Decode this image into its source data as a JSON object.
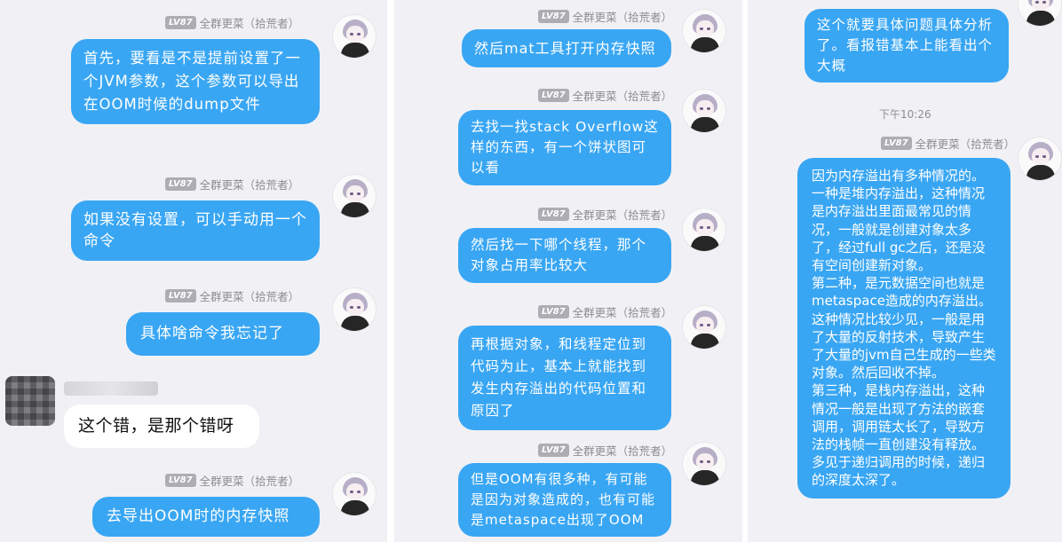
{
  "sender": {
    "level": "LV87",
    "name": "全群更菜",
    "title": "（拾荒者）"
  },
  "panel1": {
    "messages": [
      "首先，要看是不是提前设置了一个JVM参数，这个参数可以导出在OOM时候的dump文件",
      "如果没有设置，可以手动用一个命令",
      "具体啥命令我忘记了"
    ],
    "other_message": "这个错，是那个错呀",
    "last_message": "去导出OOM时的内存快照"
  },
  "panel2": {
    "messages": [
      "然后mat工具打开内存快照",
      "去找一找stack Overflow这样的东西，有一个饼状图可以看",
      "然后找一下哪个线程，那个对象占用率比较大",
      "再根据对象，和线程定位到代码为止，基本上就能找到发生内存溢出的代码位置和原因了",
      "但是OOM有很多种，有可能是因为对象造成的，也有可能是metaspace出现了OOM"
    ]
  },
  "panel3": {
    "top_message": "这个就要具体问题具体分析了。看报错基本上能看出个大概",
    "time": "下午10:26",
    "long_message": "因为内存溢出有多种情况的。\n一种是堆内存溢出，这种情况是内存溢出里面最常见的情况，一般就是创建对象太多了，经过full gc之后，还是没有空间创建新对象。\n第二种，是元数据空间也就是metaspace造成的内存溢出。这种情况比较少见，一般是用了大量的反射技术，导致产生了大量的jvm自己生成的一些类对象。然后回收不掉。\n第三种，是栈内存溢出，这种情况一般是出现了方法的嵌套调用，调用链太长了，导致方法的栈帧一直创建没有释放。多见于递归调用的时候，递归的深度太深了。"
  },
  "colors": {
    "bubble": "#39a6f3",
    "background": "#f1f1f5",
    "badge": "#adadb3"
  }
}
